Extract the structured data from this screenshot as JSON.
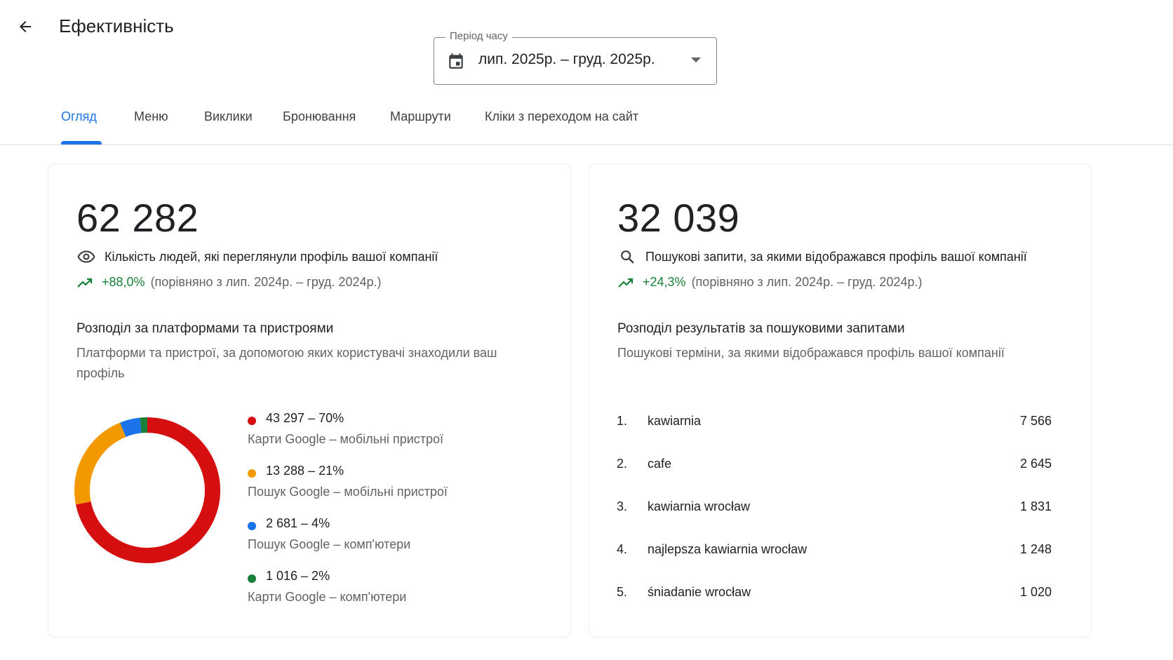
{
  "header": {
    "title": "Ефективність",
    "back_icon": "arrow-back-icon"
  },
  "period": {
    "label": "Період часу",
    "value": "лип. 2025р. – груд. 2025р.",
    "icon": "calendar-icon"
  },
  "tabs": [
    {
      "label": "Огляд",
      "active": true
    },
    {
      "label": "Меню"
    },
    {
      "label": "Виклики"
    },
    {
      "label": "Бронювання"
    },
    {
      "label": "Маршрути"
    },
    {
      "label": "Кліки з переходом на сайт"
    }
  ],
  "profile_views": {
    "value": "62 282",
    "label": "Кількість людей, які переглянули профіль вашої компанії",
    "trend_pct": "+88,0%",
    "trend_compare": "(порівняно з лип. 2024р. – груд. 2024р.)",
    "section_title": "Розподіл за платформами та пристроями",
    "section_subtitle": "Платформи та пристрої, за допомогою яких користувачі знаходили ваш профіль",
    "breakdown": [
      {
        "value": "43 297 – 70%",
        "label": "Карти Google – мобільні пристрої",
        "color": "#d50f0f",
        "share": 70
      },
      {
        "value": "13 288 – 21%",
        "label": "Пошук Google – мобільні пристрої",
        "color": "#f29900",
        "share": 21
      },
      {
        "value": "2 681 – 4%",
        "label": "Пошук Google – комп'ютери",
        "color": "#1a73e8",
        "share": 4
      },
      {
        "value": "1 016 – 2%",
        "label": "Карти Google – комп'ютери",
        "color": "#188038",
        "share": 2
      }
    ]
  },
  "search_queries": {
    "value": "32 039",
    "label": "Пошукові запити, за якими відображався профіль вашої компанії",
    "trend_pct": "+24,3%",
    "trend_compare": "(порівняно з лип. 2024р. – груд. 2024р.)",
    "section_title": "Розподіл результатів за пошуковими запитами",
    "section_subtitle": "Пошукові терміни, за якими відображався профіль вашої компанії",
    "items": [
      {
        "rank": "1.",
        "term": "kawiarnia",
        "count": "7 566"
      },
      {
        "rank": "2.",
        "term": "cafe",
        "count": "2 645"
      },
      {
        "rank": "3.",
        "term": "kawiarnia wrocław",
        "count": "1 831"
      },
      {
        "rank": "4.",
        "term": "najlepsza kawiarnia wrocław",
        "count": "1 248"
      },
      {
        "rank": "5.",
        "term": "śniadanie wrocław",
        "count": "1 020"
      }
    ]
  },
  "chart_data": {
    "type": "pie",
    "categories": [
      "Карти Google – мобільні пристрої",
      "Пошук Google – мобільні пристрої",
      "Пошук Google – комп'ютери",
      "Карти Google – комп'ютери"
    ],
    "values": [
      43297,
      13288,
      2681,
      1016
    ],
    "colors": [
      "#d50f0f",
      "#f29900",
      "#1a73e8",
      "#188038"
    ],
    "title": ""
  }
}
